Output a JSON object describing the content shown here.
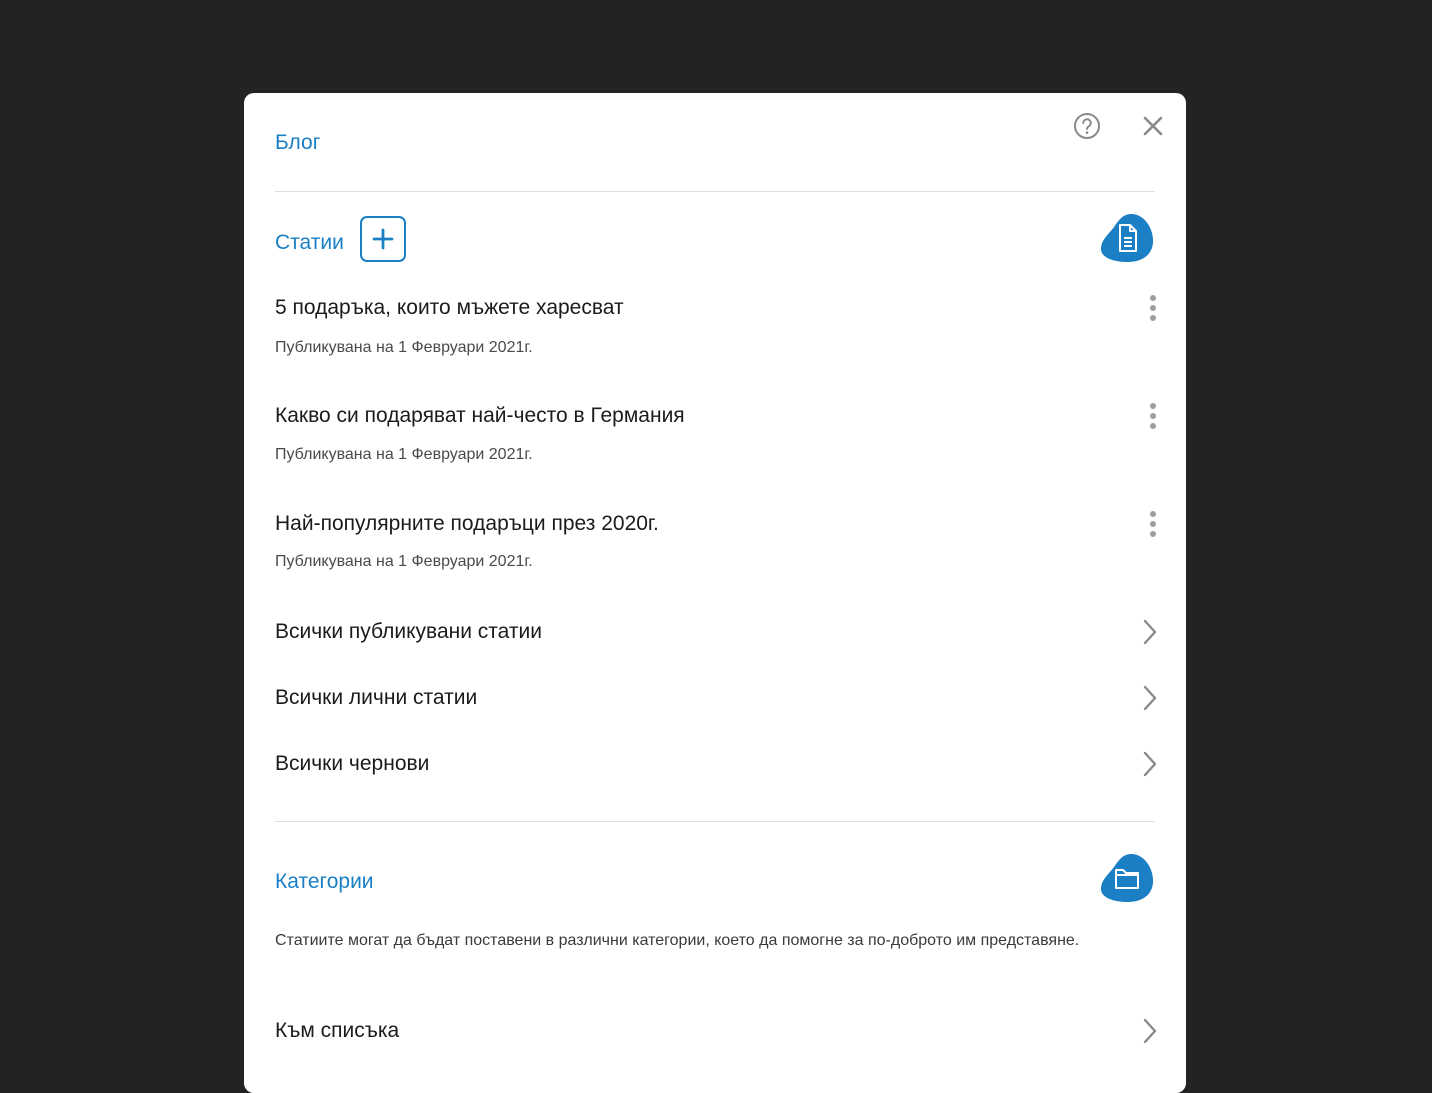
{
  "dialog": {
    "title": "Блог",
    "help_icon": "help-circle-icon",
    "close_icon": "close-icon"
  },
  "articles": {
    "heading": "Статии",
    "add_icon": "plus-icon",
    "section_icon": "document-icon",
    "items": [
      {
        "title": "5 подаръка, които мъжете харесват",
        "meta": "Публикувана на 1 Февруари 2021г."
      },
      {
        "title": "Какво си подаряват най-често в Германия",
        "meta": "Публикувана на 1 Февруари 2021г."
      },
      {
        "title": "Най-популярните подаръци през 2020г.",
        "meta": "Публикувана на 1 Февруари 2021г."
      }
    ],
    "links": [
      {
        "label": "Всички публикувани статии"
      },
      {
        "label": "Всички лични статии"
      },
      {
        "label": "Всички чернови"
      }
    ]
  },
  "categories": {
    "heading": "Категории",
    "section_icon": "folder-icon",
    "description": "Статиите могат да бъдат поставени в различни категории, което да помогне за по-доброто им представяне.",
    "link_label": "Към списъка"
  },
  "colors": {
    "accent": "#1a7fc4",
    "backdrop": "#232323",
    "text": "#1b1b1b",
    "muted_icon": "#9e9e9e"
  }
}
